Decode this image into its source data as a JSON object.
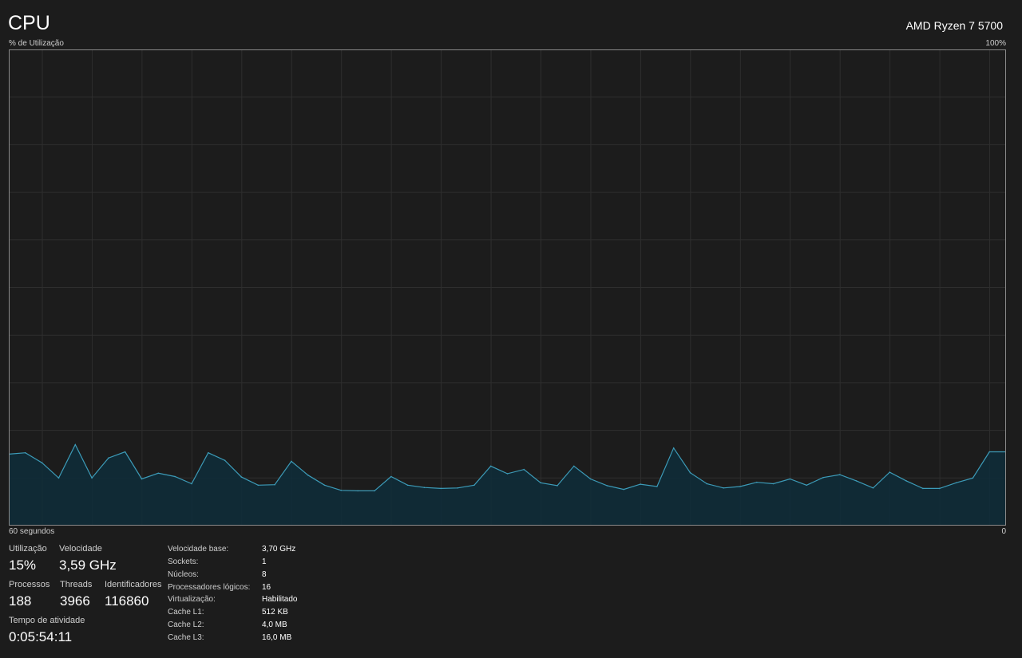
{
  "header": {
    "title": "CPU",
    "cpu_model": "AMD Ryzen 7 5700",
    "y_axis_label": "% de Utilização",
    "y_axis_max_label": "100%",
    "x_axis_left_label": "60 segundos",
    "x_axis_right_label": "0"
  },
  "colors": {
    "background": "#1c1c1c",
    "line": "#3c9bb8",
    "fill": "#0e2d3a",
    "grid": "#2e2e2e",
    "border": "#8a8a8a"
  },
  "chart_data": {
    "type": "area",
    "ylim": [
      0,
      100
    ],
    "xlim": [
      60,
      0
    ],
    "grid": true,
    "x": [
      60,
      59,
      58,
      57,
      56,
      55,
      54,
      53,
      52,
      51,
      50,
      49,
      48,
      47,
      46,
      45,
      44,
      43,
      42,
      41,
      40,
      39,
      38,
      37,
      36,
      35,
      34,
      33,
      32,
      31,
      30,
      29,
      28,
      27,
      26,
      25,
      24,
      23,
      22,
      21,
      20,
      19,
      18,
      17,
      16,
      15,
      14,
      13,
      12,
      11,
      10,
      9,
      8,
      7,
      6,
      5,
      4,
      3,
      2,
      1,
      0
    ],
    "values": [
      15,
      15.3,
      13.2,
      10,
      17,
      10,
      14.2,
      15.5,
      9.8,
      11,
      10.3,
      8.8,
      15.3,
      13.7,
      10.2,
      8.5,
      8.6,
      13.5,
      10.6,
      8.5,
      7.4,
      7.3,
      7.3,
      10.3,
      8.5,
      8,
      7.8,
      7.9,
      8.5,
      12.5,
      10.9,
      11.8,
      9,
      8.4,
      12.5,
      9.8,
      8.4,
      7.6,
      8.7,
      8.2,
      16.3,
      11.1,
      8.8,
      7.9,
      8.2,
      9.1,
      8.8,
      9.8,
      8.5,
      10.1,
      10.7,
      9.4,
      7.9,
      11.2,
      9.4,
      7.8,
      7.8,
      9,
      10,
      15.5,
      15.5
    ]
  },
  "stats": {
    "utilization_label": "Utilização",
    "utilization_value": "15%",
    "speed_label": "Velocidade",
    "speed_value": "3,59 GHz",
    "processes_label": "Processos",
    "processes_value": "188",
    "threads_label": "Threads",
    "threads_value": "3966",
    "handles_label": "Identificadores",
    "handles_value": "116860",
    "uptime_label": "Tempo de atividade",
    "uptime_value": "0:05:54:11"
  },
  "specs": [
    {
      "key": "Velocidade base:",
      "value": "3,70 GHz"
    },
    {
      "key": "Sockets:",
      "value": "1"
    },
    {
      "key": "Núcleos:",
      "value": "8"
    },
    {
      "key": "Processadores lógicos:",
      "value": "16"
    },
    {
      "key": "Virtualização:",
      "value": "Habilitado"
    },
    {
      "key": "Cache L1:",
      "value": "512 KB"
    },
    {
      "key": "Cache L2:",
      "value": "4,0 MB"
    },
    {
      "key": "Cache L3:",
      "value": "16,0 MB"
    }
  ]
}
